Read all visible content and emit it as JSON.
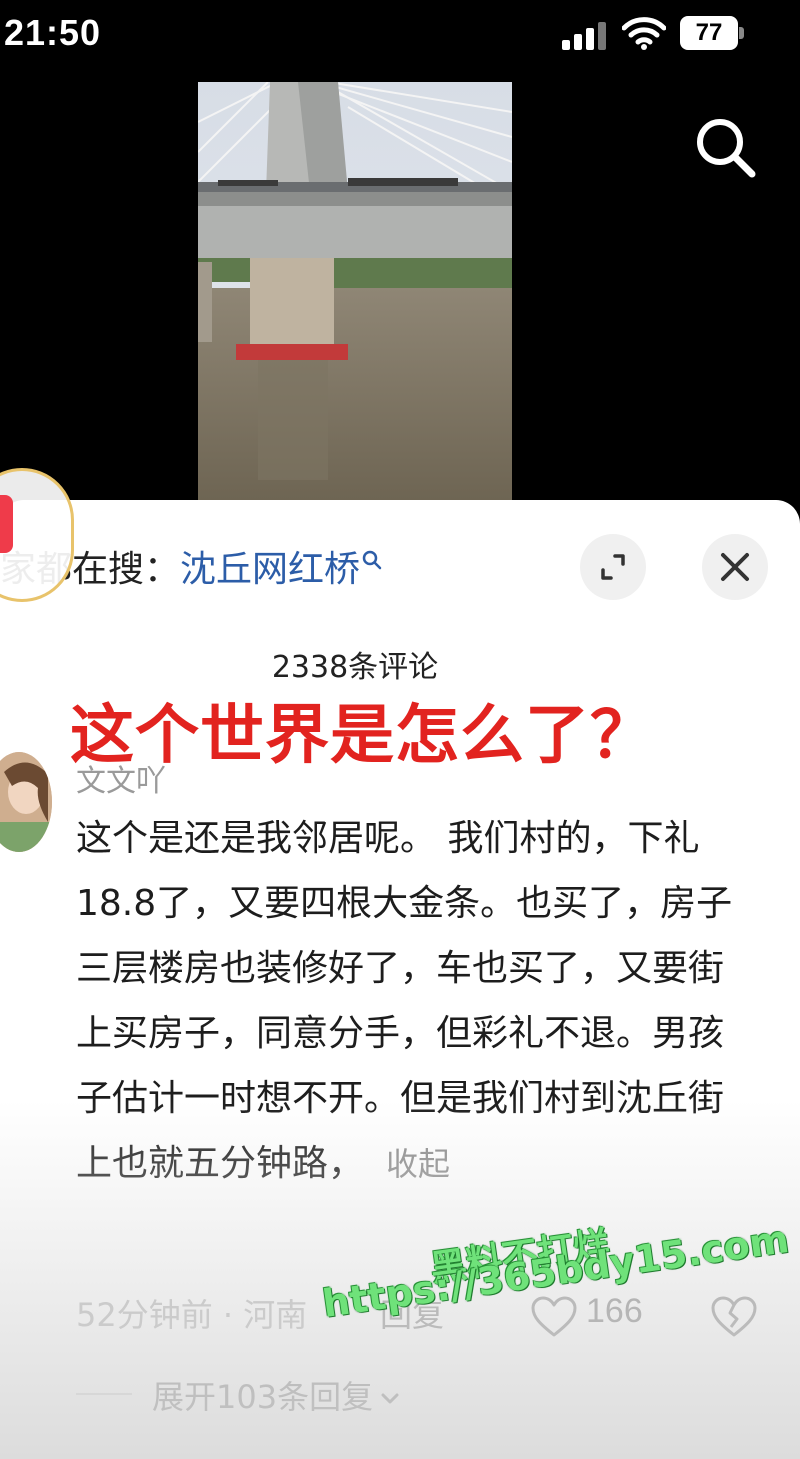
{
  "status_bar": {
    "time": "21:50",
    "battery": "77",
    "icons": [
      "signal-icon",
      "wifi-icon",
      "battery-icon"
    ]
  },
  "top_bar": {
    "icons": [
      "search-icon"
    ]
  },
  "comment_sheet": {
    "search_hint_prefix": "家都在搜：",
    "search_hint_keyword": "沈丘网红桥",
    "comment_count": "2338条评论",
    "overlay_caption": "这个世界是怎么了？",
    "icons": [
      "expand-icon",
      "close-icon"
    ]
  },
  "comment": {
    "username": "文文吖",
    "text": "这个是还是我邻居呢。 我们村的，下礼18.8了，又要四根大金条。也买了，房子三层楼房也装修好了，车也买了，又要街上买房子，同意分手，但彩礼不退。男孩子估计一时想不开。但是我们村到沈丘街上也就五分钟路，",
    "collapse_label": "收起",
    "meta": "52分钟前 · 河南",
    "reply_label": "回复",
    "like_count": "166",
    "expand_replies_label": "展开103条回复"
  },
  "watermark": {
    "line1": "黑料不打烊",
    "line2": "https://365bdy15.com"
  },
  "colors": {
    "keyword": "#2c5da8",
    "caption": "#e2231f",
    "watermark": "#6fe27a",
    "red_packet": "#ef3b4a"
  }
}
